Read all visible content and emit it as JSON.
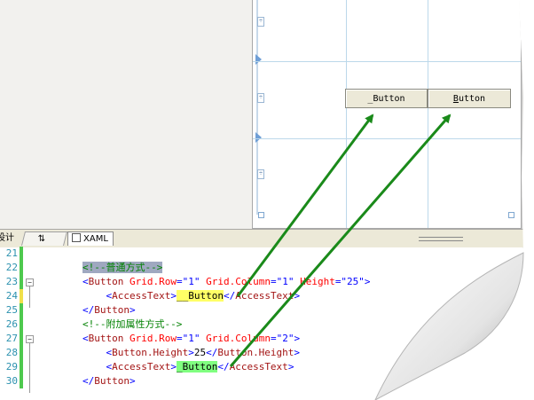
{
  "designer": {
    "buttons": [
      {
        "label": "_Button",
        "mnemonic_underlined": false
      },
      {
        "label": "Button",
        "mnemonic_underlined": true,
        "mnemonic_char": "B",
        "rest": "utton"
      }
    ],
    "rail_markers": [
      "÷",
      "÷",
      "÷"
    ]
  },
  "tabs": {
    "design": "设计",
    "swap": "⇅",
    "xaml": "XAML"
  },
  "code": {
    "lines": [
      {
        "num": "21",
        "change": "green",
        "fold": "",
        "segments": []
      },
      {
        "num": "22",
        "change": "green",
        "fold": "",
        "segments": [
          {
            "cls": "txt",
            "text": "        "
          },
          {
            "cls": "cmt hl-gray",
            "text": "<!--普通方式-->"
          }
        ]
      },
      {
        "num": "23",
        "change": "green",
        "fold": "minus",
        "segments": [
          {
            "cls": "txt",
            "text": "        "
          },
          {
            "cls": "val",
            "text": "<"
          },
          {
            "cls": "tag",
            "text": "Button"
          },
          {
            "cls": "attr",
            "text": " Grid.Row"
          },
          {
            "cls": "val",
            "text": "=\"1\""
          },
          {
            "cls": "attr",
            "text": " Grid.Column"
          },
          {
            "cls": "val",
            "text": "=\"1\""
          },
          {
            "cls": "attr",
            "text": " Height"
          },
          {
            "cls": "val",
            "text": "=\"25\">"
          }
        ]
      },
      {
        "num": "24",
        "change": "yellow",
        "fold": "",
        "segments": [
          {
            "cls": "txt",
            "text": "            "
          },
          {
            "cls": "val",
            "text": "<"
          },
          {
            "cls": "tag",
            "text": "AccessText"
          },
          {
            "cls": "val",
            "text": ">"
          },
          {
            "cls": "txt hl-yellow",
            "text": "__Button"
          },
          {
            "cls": "val",
            "text": "</"
          },
          {
            "cls": "tag",
            "text": "AccessText"
          },
          {
            "cls": "val",
            "text": ">"
          }
        ]
      },
      {
        "num": "25",
        "change": "green",
        "fold": "",
        "segments": [
          {
            "cls": "txt",
            "text": "        "
          },
          {
            "cls": "val",
            "text": "</"
          },
          {
            "cls": "tag",
            "text": "Button"
          },
          {
            "cls": "val",
            "text": ">"
          }
        ]
      },
      {
        "num": "26",
        "change": "green",
        "fold": "",
        "segments": [
          {
            "cls": "txt",
            "text": "        "
          },
          {
            "cls": "cmt",
            "text": "<!--附加属性方式-->"
          }
        ]
      },
      {
        "num": "27",
        "change": "green",
        "fold": "minus",
        "segments": [
          {
            "cls": "txt",
            "text": "        "
          },
          {
            "cls": "val",
            "text": "<"
          },
          {
            "cls": "tag",
            "text": "Button"
          },
          {
            "cls": "attr",
            "text": " Grid.Row"
          },
          {
            "cls": "val",
            "text": "=\"1\""
          },
          {
            "cls": "attr",
            "text": " Grid.Column"
          },
          {
            "cls": "val",
            "text": "=\"2\">"
          }
        ]
      },
      {
        "num": "28",
        "change": "green",
        "fold": "",
        "segments": [
          {
            "cls": "txt",
            "text": "            "
          },
          {
            "cls": "val",
            "text": "<"
          },
          {
            "cls": "tag",
            "text": "Button.Height"
          },
          {
            "cls": "val",
            "text": ">"
          },
          {
            "cls": "txt",
            "text": "25"
          },
          {
            "cls": "val",
            "text": "</"
          },
          {
            "cls": "tag",
            "text": "Button.Height"
          },
          {
            "cls": "val",
            "text": ">"
          }
        ]
      },
      {
        "num": "29",
        "change": "green",
        "fold": "",
        "segments": [
          {
            "cls": "txt",
            "text": "            "
          },
          {
            "cls": "val",
            "text": "<"
          },
          {
            "cls": "tag",
            "text": "AccessText"
          },
          {
            "cls": "val",
            "text": ">"
          },
          {
            "cls": "txt hl-green",
            "text": "_Button"
          },
          {
            "cls": "val",
            "text": "</"
          },
          {
            "cls": "tag",
            "text": "AccessText"
          },
          {
            "cls": "val",
            "text": ">"
          }
        ]
      },
      {
        "num": "30",
        "change": "green",
        "fold": "",
        "segments": [
          {
            "cls": "txt",
            "text": "        "
          },
          {
            "cls": "val",
            "text": "</"
          },
          {
            "cls": "tag",
            "text": "Button"
          },
          {
            "cls": "val",
            "text": ">"
          }
        ]
      }
    ]
  },
  "colors": {
    "change_green": "#4ec94e",
    "change_yellow": "#f0e04a",
    "arrow": "#1a8a1a"
  }
}
